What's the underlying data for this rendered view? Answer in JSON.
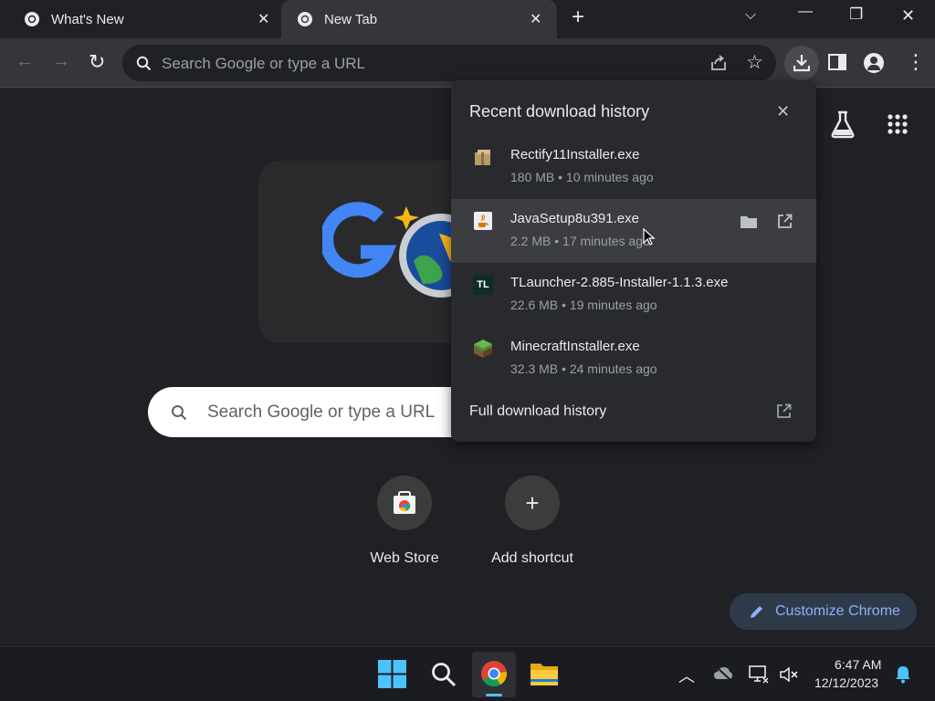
{
  "tabs": [
    {
      "title": "What's New"
    },
    {
      "title": "New Tab"
    }
  ],
  "toolbar": {
    "omnibox_placeholder": "Search Google or type a URL"
  },
  "ntp": {
    "search_placeholder": "Search Google or type a URL",
    "shortcuts": [
      {
        "label": "Web Store",
        "icon": "webstore-icon"
      },
      {
        "label": "Add shortcut",
        "icon": "plus-icon"
      }
    ],
    "customize_label": "Customize Chrome"
  },
  "downloads": {
    "title": "Recent download history",
    "items": [
      {
        "name": "Rectify11Installer.exe",
        "meta": "180 MB • 10 minutes ago",
        "icon": "package-icon"
      },
      {
        "name": "JavaSetup8u391.exe",
        "meta": "2.2 MB • 17 minutes ago",
        "icon": "java-icon"
      },
      {
        "name": "TLauncher-2.885-Installer-1.1.3.exe",
        "meta": "22.6 MB • 19 minutes ago",
        "icon": "tlauncher-icon"
      },
      {
        "name": "MinecraftInstaller.exe",
        "meta": "32.3 MB • 24 minutes ago",
        "icon": "minecraft-icon"
      }
    ],
    "tl_badge": "TL",
    "full_history": "Full download history"
  },
  "taskbar": {
    "time": "6:47 AM",
    "date": "12/12/2023"
  },
  "colors": {
    "accent": "#8ab4f8",
    "bg": "#202124",
    "toolbar": "#35363a",
    "bubble": "#292a2d"
  }
}
